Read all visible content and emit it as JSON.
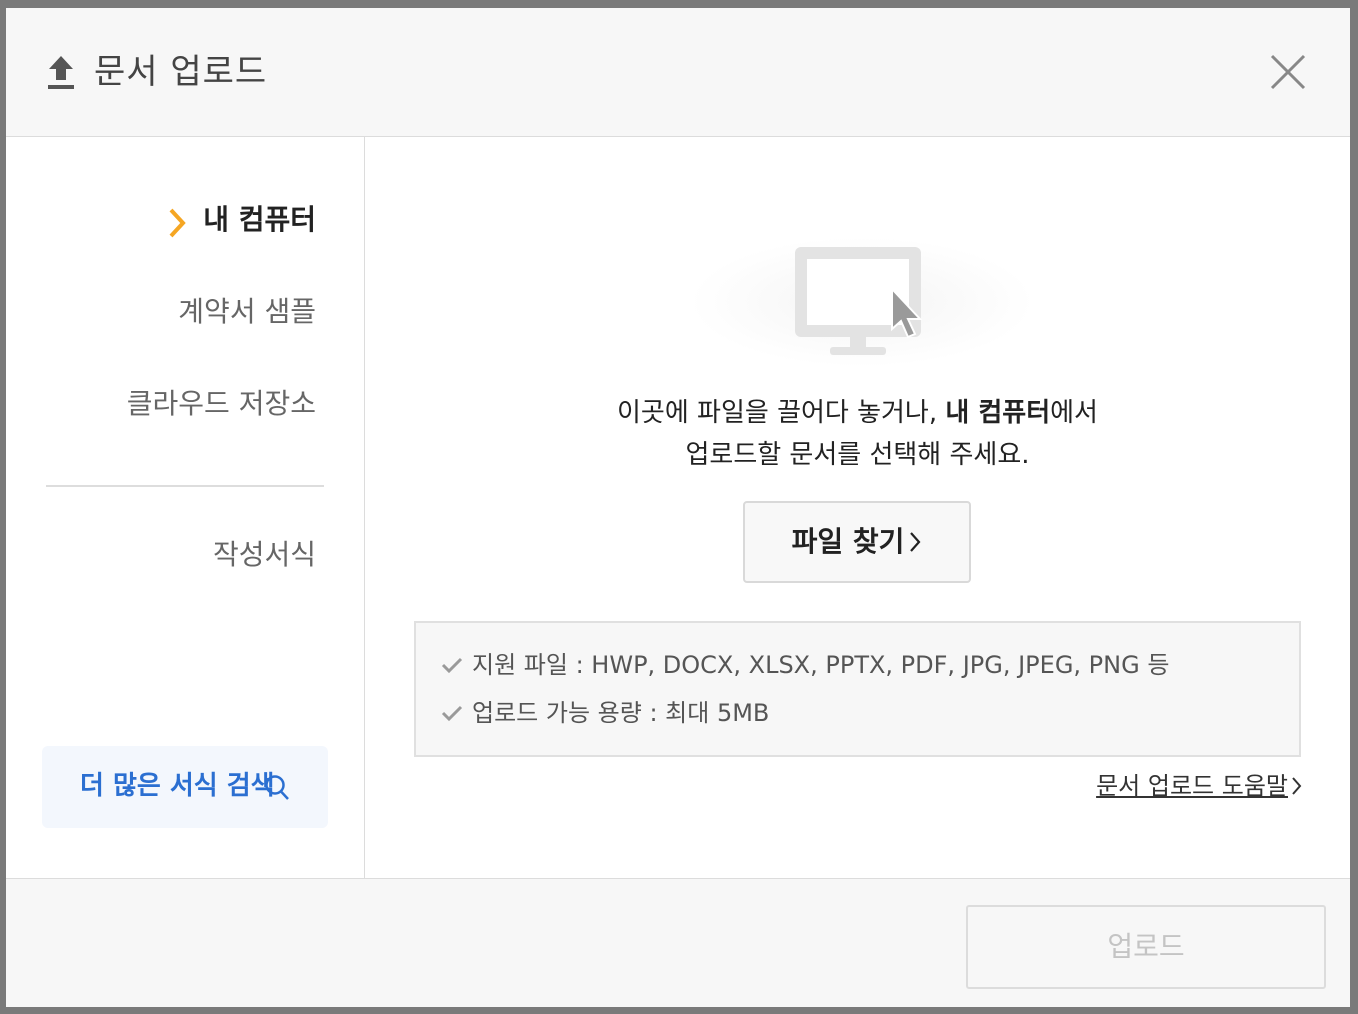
{
  "dialog": {
    "title": "문서 업로드",
    "title_icon": "upload-icon",
    "close_icon": "close-icon"
  },
  "sidebar": {
    "items": [
      {
        "label": "내 컴퓨터",
        "active": true
      },
      {
        "label": "계약서 샘플",
        "active": false
      },
      {
        "label": "클라우드 저장소",
        "active": false
      },
      {
        "label": "작성서식",
        "active": false
      }
    ],
    "more_label": "더 많은 서식 검색",
    "more_icon": "search-icon",
    "accent_color": "#f5a623",
    "link_color": "#2b6fd1"
  },
  "main": {
    "illustration_icon": "monitor-cursor-icon",
    "instruction_part1": "이곳에 파일을 끌어다 놓거나, ",
    "instruction_bold": "내 컴퓨터",
    "instruction_part2": "에서",
    "instruction_line2": "업로드할 문서를 선택해 주세요.",
    "find_button": "파일 찾기",
    "info": [
      "지원 파일 : HWP, DOCX, XLSX, PPTX, PDF, JPG, JPEG, PNG 등",
      "업로드 가능 용량 : 최대 5MB"
    ],
    "help_link": "문서 업로드 도움말"
  },
  "footer": {
    "upload_button": "업로드"
  }
}
